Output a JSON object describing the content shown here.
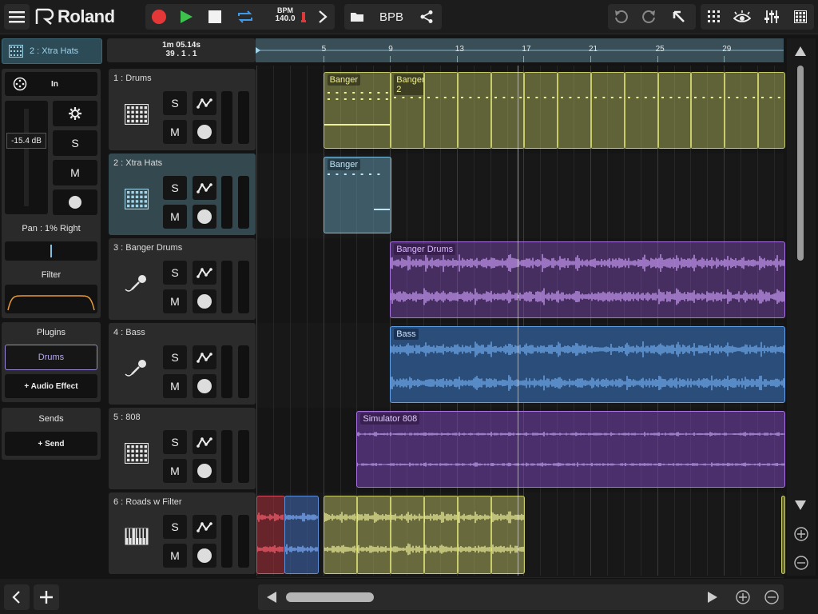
{
  "toolbar": {
    "brand": "Roland",
    "bpm_label": "BPM",
    "bpm_value": "140.0",
    "bpb_label": "BPB"
  },
  "selected_track": {
    "label": "2 : Xtra Hats"
  },
  "timeline": {
    "time": "1m 05.14s",
    "position": "39 . 1 . 1",
    "markers": [
      "5",
      "9",
      "13",
      "17",
      "21",
      "25",
      "29"
    ]
  },
  "inspector": {
    "input_label": "In",
    "volume": "-15.4 dB",
    "solo": "S",
    "mute": "M",
    "pan": "Pan : 1% Right",
    "filter_label": "Filter",
    "plugins_label": "Plugins",
    "plugin_item": "Drums",
    "add_audio_effect": "+ Audio Effect",
    "sends_label": "Sends",
    "add_send": "+ Send"
  },
  "tracks": [
    {
      "name": "1 : Drums",
      "type": "drum-pad-icon",
      "solo": "S",
      "mute": "M"
    },
    {
      "name": "2 : Xtra Hats",
      "type": "drum-pad-icon",
      "solo": "S",
      "mute": "M"
    },
    {
      "name": "3 : Banger Drums",
      "type": "microphone-icon",
      "solo": "S",
      "mute": "M"
    },
    {
      "name": "4 : Bass",
      "type": "microphone-icon",
      "solo": "S",
      "mute": "M"
    },
    {
      "name": "5 : 808",
      "type": "drum-pad-icon",
      "solo": "S",
      "mute": "M"
    },
    {
      "name": "6 : Roads w Filter",
      "type": "keyboard-icon",
      "solo": "S",
      "mute": "M"
    }
  ],
  "clips": {
    "drums_1": "Banger",
    "drums_2": "Banger 2",
    "hats_1": "Banger",
    "banger_drums": "Banger Drums",
    "bass": "Bass",
    "sim808": "Simulator 808"
  },
  "colors": {
    "yellow": "#c9cc6a",
    "blue": "#7fc0e0",
    "purple": "#a872e0",
    "bass_blue": "#5f9fe8",
    "record": "#e43838",
    "play": "#3ec24e"
  }
}
